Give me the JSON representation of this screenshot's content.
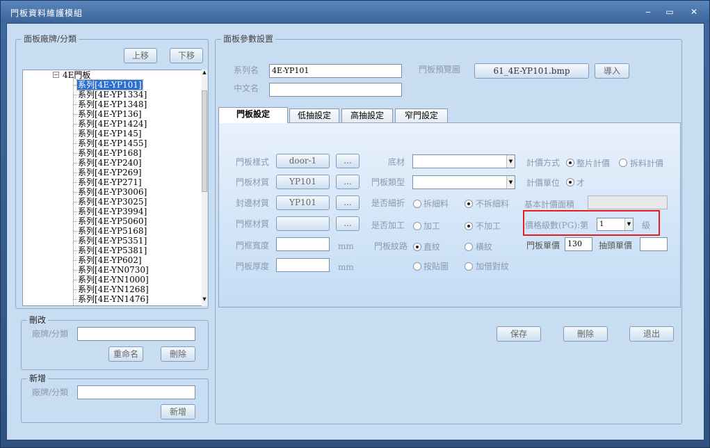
{
  "window": {
    "title": "門板資料維護模組",
    "min": "‒",
    "max": "▭",
    "close": "✕"
  },
  "left": {
    "group_title": "面板廠牌/分類",
    "up_button": "上移",
    "down_button": "下移",
    "tree_root": "4E門板",
    "tree_items": [
      "系列[4E-YP101]",
      "系列[4E-YP1334]",
      "系列[4E-YP1348]",
      "系列[4E-YP136]",
      "系列[4E-YP1424]",
      "系列[4E-YP145]",
      "系列[4E-YP1455]",
      "系列[4E-YP168]",
      "系列[4E-YP240]",
      "系列[4E-YP269]",
      "系列[4E-YP271]",
      "系列[4E-YP3006]",
      "系列[4E-YP3025]",
      "系列[4E-YP3994]",
      "系列[4E-YP5060]",
      "系列[4E-YP5168]",
      "系列[4E-YP5351]",
      "系列[4E-YP5381]",
      "系列[4E-YP602]",
      "系列[4E-YN0730]",
      "系列[4E-YN1000]",
      "系列[4E-YN1268]",
      "系列[4E-YN1476]"
    ],
    "selected_index": 0,
    "edit": {
      "title": "刪改",
      "label": "廠牌/分類",
      "value": "",
      "rename_button": "重命名",
      "delete_button": "刪除"
    },
    "add": {
      "title": "新增",
      "label": "廠牌/分類",
      "value": "",
      "add_button": "新增"
    }
  },
  "right": {
    "group_title": "面板參數設置",
    "series_label": "系列名",
    "series_value": "4E-YP101",
    "chinese_label": "中文名",
    "chinese_value": "",
    "preview_label": "門板預覽圖",
    "preview_file": "61_4E-YP101.bmp",
    "import_button": "導入",
    "tabs": [
      "門板設定",
      "低抽設定",
      "高抽設定",
      "窄門設定"
    ],
    "active_tab": 0,
    "form": {
      "door_style_label": "門板樣式",
      "door_style_value": "door-1",
      "ellipsis": "...",
      "door_material_label": "門板材質",
      "door_material_value": "YP101",
      "edge_material_label": "封邊材質",
      "edge_material_value": "YP101",
      "frame_material_label": "門框材質",
      "frame_material_value": "",
      "frame_width_label": "門框寬度",
      "frame_width_value": "",
      "unit_mm": "mm",
      "door_thickness_label": "門板厚度",
      "door_thickness_value": "",
      "base_label": "底材",
      "base_value": "",
      "door_type_label": "門板類型",
      "door_type_value": "",
      "split_label": "是否細折",
      "split_opt1": "拆細料",
      "split_opt2": "不拆細料",
      "split_selected": 2,
      "process_label": "是否加工",
      "process_opt1": "加工",
      "process_opt2": "不加工",
      "process_selected": 2,
      "grain_label": "門板紋路",
      "grain_opt1": "直紋",
      "grain_opt2": "橫紋",
      "grain_opt3": "按貼圖",
      "grain_opt4": "加借對紋",
      "grain_selected": 1,
      "pricing_label": "計價方式",
      "pricing_opt1": "整片計價",
      "pricing_opt2": "拆料計價",
      "pricing_selected": 1,
      "unit_label": "計價單位",
      "unit_opt1": "才",
      "base_area_label": "基本計價面積",
      "base_area_value": "",
      "price_level_label": "價格級數(PG):第",
      "price_level_value": "1",
      "price_level_suffix": "級",
      "door_price_label": "門板單價",
      "door_price_value": "130",
      "drawer_price_label": "抽頭單價",
      "drawer_price_value": ""
    },
    "save_button": "保存",
    "delete_button": "刪除",
    "exit_button": "退出"
  }
}
